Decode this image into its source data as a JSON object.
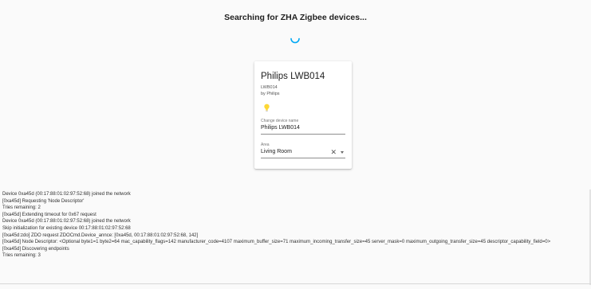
{
  "header": {
    "title": "Searching for ZHA Zigbee devices..."
  },
  "device_card": {
    "name": "Philips LWB014",
    "model": "LWB014",
    "manufacturer": "by Philips",
    "icon": "lightbulb-icon",
    "icon_color": "#fdd835",
    "name_field": {
      "label": "Change device name",
      "value": "Philips LWB014"
    },
    "area_field": {
      "label": "Area",
      "value": "Living Room"
    }
  },
  "colors": {
    "accent": "#03a9f4",
    "background": "#fafafa",
    "card": "#ffffff"
  },
  "log": [
    "Device 0xa45d (00:17:88:01:02:97:52:68) joined the network",
    "[0xa45d] Requesting 'Node Descriptor'",
    "Tries remaining: 2",
    "[0xa45d] Extending timeout for 0x67 request",
    "Device 0xa45d (00:17:88:01:02:97:52:68) joined the network",
    "Skip initialization for existing device 00:17:88:01:02:97:52:68",
    "[0xa45d:zdo] ZDO request ZDOCmd.Device_annce: [0xa45d, 00:17:88:01:02:97:52:68, 142]",
    "[0xa45d] Node Descriptor: <Optional byte1=1 byte2=64 mac_capability_flags=142 manufacturer_code=4107 maximum_buffer_size=71 maximum_incoming_transfer_size=45 server_mask=0 maximum_outgoing_transfer_size=45 descriptor_capability_field=0>",
    "[0xa45d] Discovering endpoints",
    "Tries remaining: 3"
  ]
}
